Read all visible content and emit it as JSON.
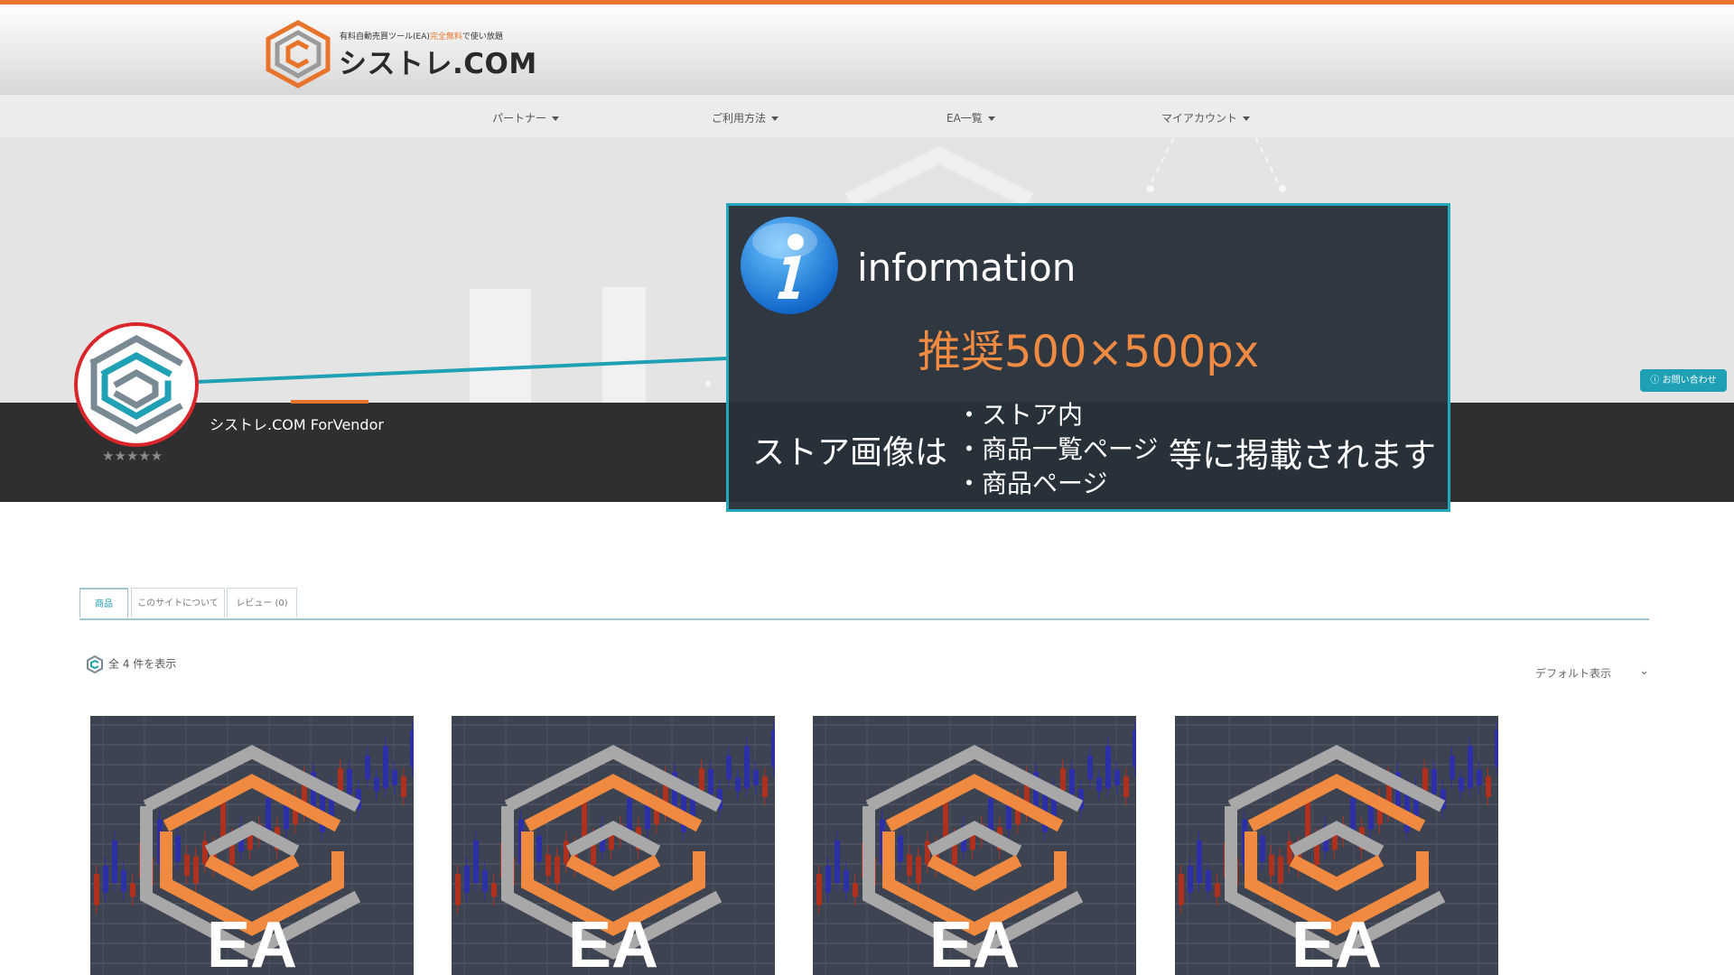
{
  "header": {
    "tagline_prefix": "有料自動売買ツール(EA)",
    "tagline_highlight": "完全無料",
    "tagline_suffix": "で使い放題",
    "logo_text": "シストレ.COM"
  },
  "nav": {
    "items": [
      {
        "label": "パートナー"
      },
      {
        "label": "ご利用方法"
      },
      {
        "label": "EA一覧"
      },
      {
        "label": "マイアカウント"
      }
    ]
  },
  "store": {
    "vendor_name": "シストレ.COM ForVendor",
    "rating_stars": "★★★★★",
    "rating_value": 0,
    "contact_label": "お問い合わせ"
  },
  "info": {
    "title": "information",
    "recommended_size": "推奨500×500px",
    "lead": "ストア画像は",
    "bullets": [
      "・ストア内",
      "・商品一覧ページ",
      "・商品ページ"
    ],
    "tail": "等に掲載されます"
  },
  "tabs": [
    {
      "label": "商品",
      "active": true
    },
    {
      "label": "このサイトについて",
      "active": false
    },
    {
      "label": "レビュー (0)",
      "active": false
    }
  ],
  "results": {
    "count_text": "全 4 件を表示",
    "sort_label": "デフォルト表示"
  },
  "products": [
    {
      "badge": "EA"
    },
    {
      "badge": "EA"
    },
    {
      "badge": "EA"
    },
    {
      "badge": "EA"
    }
  ],
  "colors": {
    "accent": "#e8742c",
    "teal": "#1fa0b5",
    "dark_band": "#2f2f2f",
    "info_bg": "#283039"
  }
}
